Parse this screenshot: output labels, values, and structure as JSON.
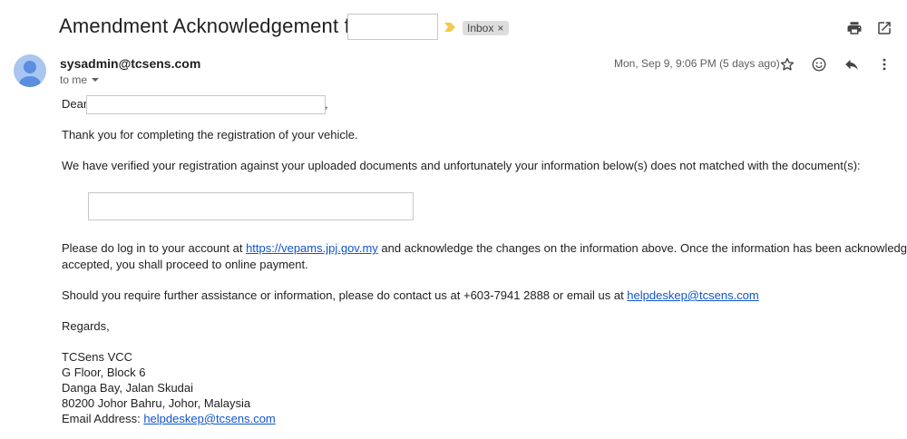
{
  "email": {
    "subject": "Amendment Acknowledgement for",
    "label": "Inbox",
    "label_close": "×",
    "sender": "sysadmin@tcsens.com",
    "recipient": "to me",
    "date": "Mon, Sep 9, 9:06 PM (5 days ago)"
  },
  "icons": {
    "print": "print-icon",
    "open_new_window": "open-in-new-window-icon",
    "star": "star-icon",
    "emoji": "emoji-icon",
    "reply": "reply-icon",
    "more": "more-vert-icon",
    "importance": "importance-marker-icon",
    "avatar": "default-avatar-icon",
    "dropdown": "chevron-down-icon"
  },
  "colors": {
    "link": "#1155cc",
    "importance": "#f2c94c",
    "avatar": "#a8c6f0",
    "chip": "#dddddd"
  },
  "body": {
    "greeting": "Dear",
    "greeting_comma": ",",
    "p1": "Thank you for completing the registration of your vehicle.",
    "p2": "We have verified your registration against your uploaded documents and unfortunately your information below(s) does not matched with the document(s):",
    "p3_pre": "Please do log in to your account at ",
    "p3_link": "https://vepams.jpj.gov.my",
    "p3_post_line1": " and acknowledge the changes on the information above. Once the information has been acknowledged and",
    "p3_line2": "accepted, you shall proceed to online payment.",
    "p4_pre": "Should you require further assistance or information, please do contact us at +603-7941 2888 or email us at ",
    "p4_link": "helpdeskep@tcsens.com",
    "regards": "Regards,",
    "sig_company": "TCSens VCC",
    "sig_floor": "G Floor, Block 6",
    "sig_street": "Danga Bay, Jalan Skudai",
    "sig_city": "80200 Johor Bahru, Johor, Malaysia",
    "sig_email_label": "Email Address: ",
    "sig_email": "helpdeskep@tcsens.com"
  }
}
